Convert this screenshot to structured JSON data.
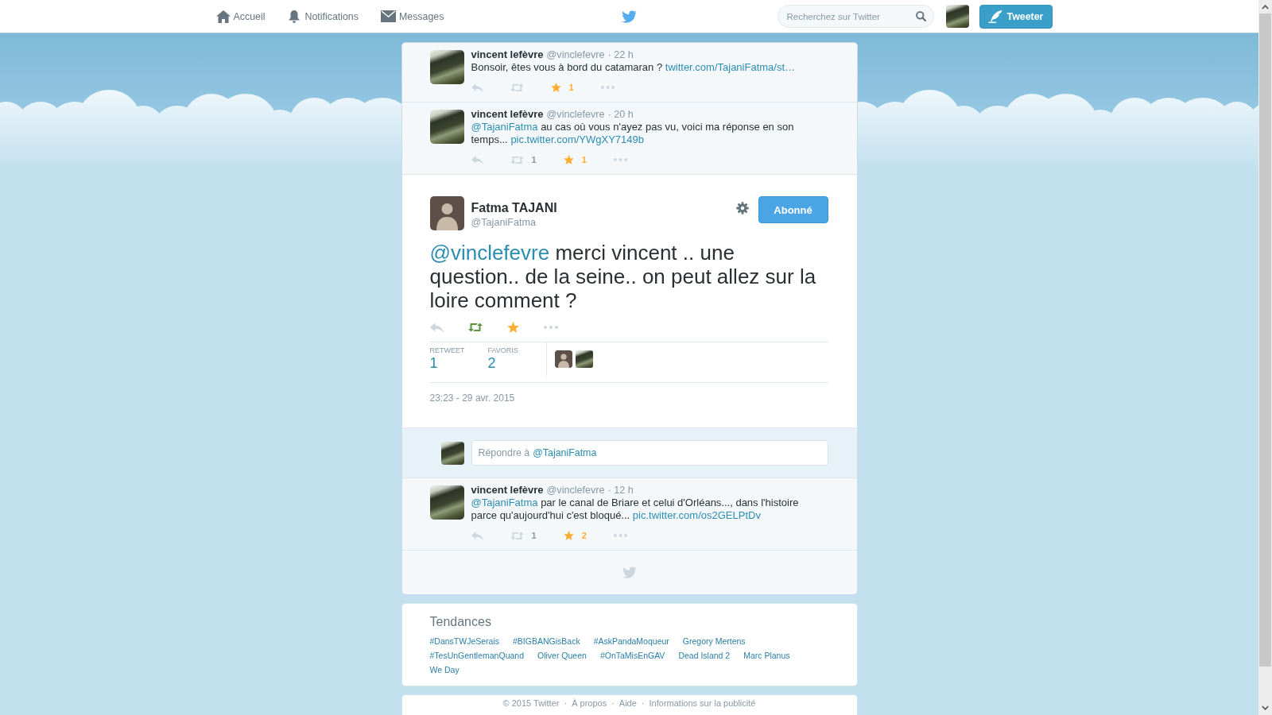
{
  "nav": {
    "items": [
      {
        "kind": "home",
        "label": "Accueil",
        "selected": false
      },
      {
        "kind": "notifications",
        "label": "Notifications",
        "selected": false
      },
      {
        "kind": "messages",
        "label": "Messages",
        "selected": false
      }
    ],
    "search": {
      "placeholder": "Recherchez sur Twitter"
    },
    "tweet_button": {
      "label": "Tweeter"
    }
  },
  "conversation": {
    "ancestors": [
      {
        "name": "vincent lefèvre",
        "handle": "@vinclefevre",
        "time": "· 22 h",
        "text": [
          {
            "kind": "text",
            "text": "Bonsoir, êtes vous à bord du catamaran ?"
          },
          {
            "kind": "link",
            "text": "twitter.com/TajaniFatma/st…"
          }
        ],
        "retweeted": false,
        "favorited": true,
        "favorite_count": "1"
      },
      {
        "name": "vincent lefèvre",
        "handle": "@vinclefevre",
        "time": "· 20 h",
        "text": [
          {
            "kind": "mention",
            "text": "@TajaniFatma"
          },
          {
            "kind": "text",
            "text": "au cas où vous n'ayez pas vu, voici ma réponse en son temps..."
          },
          {
            "kind": "link",
            "text": "pic.twitter.com/YWgXY7149b"
          }
        ],
        "retweeted": false,
        "retweet_count": "1",
        "favorited": true,
        "favorite_count": "1"
      }
    ],
    "main": {
      "name": "Fatma TAJANI",
      "handle": "@TajaniFatma",
      "follow_button": "Abonné",
      "text": [
        {
          "kind": "mention",
          "text": "@vinclefevre"
        },
        {
          "kind": "text",
          "text": "merci vincent .. une question.. de la seine.. on peut allez sur la loire comment ?"
        }
      ],
      "retweeted": true,
      "favorited": true,
      "stats": [
        {
          "label": "RETWEET",
          "count": "1"
        },
        {
          "label": "FAVORIS",
          "count": "2"
        }
      ],
      "date": "23:23 - 29 avr. 2015"
    },
    "reply": {
      "placeholder": "Répondre à",
      "mention": "@TajaniFatma"
    },
    "replies": [
      {
        "name": "vincent lefèvre",
        "handle": "@vinclefevre",
        "time": "· 12 h",
        "text": [
          {
            "kind": "mention",
            "text": "@TajaniFatma"
          },
          {
            "kind": "text",
            "text": "par le canal de Briare et celui d'Orléans..., dans l'histoire parce qu'aujourd'hui c'est bloqué..."
          },
          {
            "kind": "link",
            "text": "pic.twitter.com/os2GELPtDv"
          }
        ],
        "retweeted": false,
        "retweet_count": "1",
        "favorited": true,
        "favorite_count": "2"
      }
    ]
  },
  "trends": {
    "title": "Tendances",
    "items": [
      "#DansTWJeSerais",
      "#BIGBANGisBack",
      "#AskPandaMoqueur",
      "Gregory Mertens",
      "#TesUnGentlemanQuand",
      "Oliver Queen",
      "#OnTaMisEnGAV",
      "Dead Island 2",
      "Marc Planus",
      "We Day"
    ]
  },
  "footer": {
    "copyright": "© 2015 Twitter",
    "links": [
      {
        "separator": "·",
        "text": "À propos"
      },
      {
        "separator": "·",
        "text": "Aide"
      },
      {
        "separator": "·",
        "text": "Informations sur la publicité"
      }
    ]
  }
}
